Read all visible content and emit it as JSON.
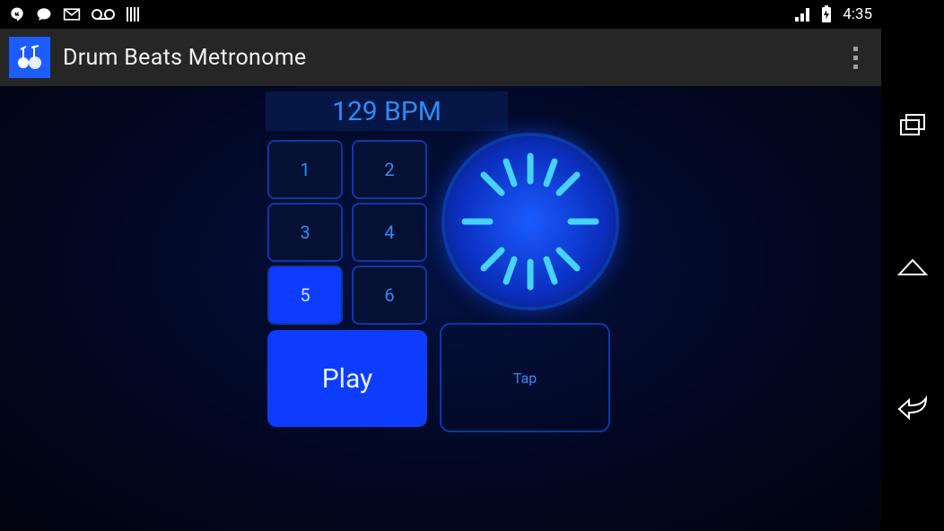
{
  "status": {
    "time": "4:35",
    "left_icons": [
      "hangouts-icon",
      "chat-icon",
      "mail-icon",
      "voicemail-icon",
      "barcode-icon"
    ],
    "right_icons": [
      "signal-icon",
      "battery-charging-icon"
    ]
  },
  "app": {
    "title": "Drum Beats Metronome"
  },
  "bpm": {
    "value": 129,
    "display": "129 BPM"
  },
  "pads": [
    {
      "label": "1",
      "active": false
    },
    {
      "label": "2",
      "active": false
    },
    {
      "label": "3",
      "active": false
    },
    {
      "label": "4",
      "active": false
    },
    {
      "label": "5",
      "active": true
    },
    {
      "label": "6",
      "active": false
    }
  ],
  "buttons": {
    "play": "Play",
    "tap": "Tap"
  },
  "colors": {
    "accent": "#0e3cff",
    "accent_light": "#2a8dff",
    "border": "#0a3aa8",
    "bg_deep": "#02081f"
  }
}
